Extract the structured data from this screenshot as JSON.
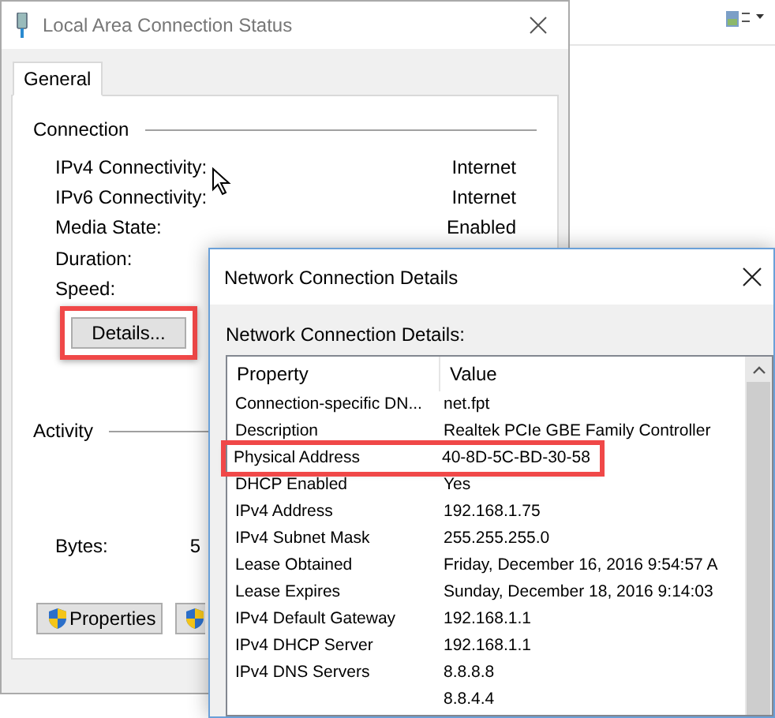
{
  "status_window": {
    "title": "Local Area Connection Status",
    "tabs": [
      {
        "label": "General",
        "selected": true
      }
    ],
    "connection": {
      "heading": "Connection",
      "rows": [
        {
          "label": "IPv4 Connectivity:",
          "value": "Internet"
        },
        {
          "label": "IPv6 Connectivity:",
          "value": "Internet"
        },
        {
          "label": "Media State:",
          "value": "Enabled"
        },
        {
          "label": "Duration:"
        },
        {
          "label": "Speed:"
        }
      ]
    },
    "details_button": {
      "label": "Details...",
      "highlighted": true
    },
    "activity": {
      "heading": "Activity",
      "bytes_label": "Bytes:",
      "bytes_value": "5"
    },
    "buttons": [
      {
        "kind": "labeled",
        "label": "Properties"
      },
      {
        "kind": "icon_only"
      }
    ]
  },
  "details_window": {
    "title": "Network Connection Details",
    "caption": "Network Connection Details:",
    "columns": [
      "Property",
      "Value"
    ],
    "rows": [
      {
        "property": "Connection-specific DN...",
        "value": "net.fpt",
        "highlighted": false
      },
      {
        "property": "Description",
        "value": "Realtek PCIe GBE Family Controller",
        "highlighted": false
      },
      {
        "property": "Physical Address",
        "value": "40-8D-5C-BD-30-58",
        "highlighted": true
      },
      {
        "property": "DHCP Enabled",
        "value": "Yes",
        "highlighted": false
      },
      {
        "property": "IPv4 Address",
        "value": "192.168.1.75",
        "highlighted": false
      },
      {
        "property": "IPv4 Subnet Mask",
        "value": "255.255.255.0",
        "highlighted": false
      },
      {
        "property": "Lease Obtained",
        "value": "Friday, December 16, 2016 9:54:57 A",
        "highlighted": false
      },
      {
        "property": "Lease Expires",
        "value": "Sunday, December 18, 2016 9:14:03",
        "highlighted": false
      },
      {
        "property": "IPv4 Default Gateway",
        "value": "192.168.1.1",
        "highlighted": false
      },
      {
        "property": "IPv4 DHCP Server",
        "value": "192.168.1.1",
        "highlighted": false
      },
      {
        "property": "IPv4 DNS Servers",
        "value": "8.8.8.8",
        "highlighted": false
      },
      {
        "property": "",
        "value": "8.8.4.4",
        "highlighted": false
      }
    ]
  }
}
